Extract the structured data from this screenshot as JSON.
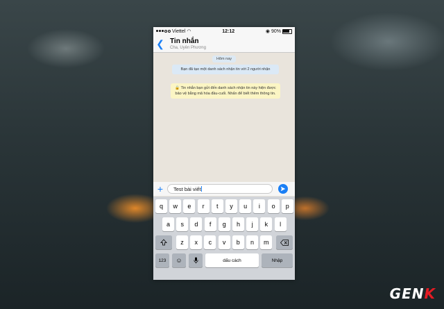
{
  "status_bar": {
    "carrier": "Viettel",
    "time": "12:12",
    "battery": "90%"
  },
  "header": {
    "title": "Tin nhắn",
    "subtitle": "Cha, Uyên Phương"
  },
  "chat": {
    "date_label": "Hôm nay",
    "system_message": "Bạn đã tạo một danh sách nhận tin với 2 người nhận",
    "encryption_notice": "🔒 Tin nhắn bạn gửi đến danh sách nhận tin này hiện được bảo vệ bằng mã hóa đầu-cuối. Nhấn để biết thêm thông tin."
  },
  "composer": {
    "text": "Test bài viết"
  },
  "keyboard": {
    "row1": [
      "q",
      "w",
      "e",
      "r",
      "t",
      "y",
      "u",
      "i",
      "o",
      "p"
    ],
    "row2": [
      "a",
      "s",
      "d",
      "f",
      "g",
      "h",
      "j",
      "k",
      "l"
    ],
    "row3": [
      "z",
      "x",
      "c",
      "v",
      "b",
      "n",
      "m"
    ],
    "numbers_label": "123",
    "space_label": "dấu cách",
    "return_label": "Nhập"
  },
  "watermark": "GENK",
  "colors": {
    "accent": "#1a7ff5",
    "chat_bg": "#e9e4dc",
    "notice_bg": "#fbf5c4",
    "system_bg": "#dbe9f6"
  }
}
